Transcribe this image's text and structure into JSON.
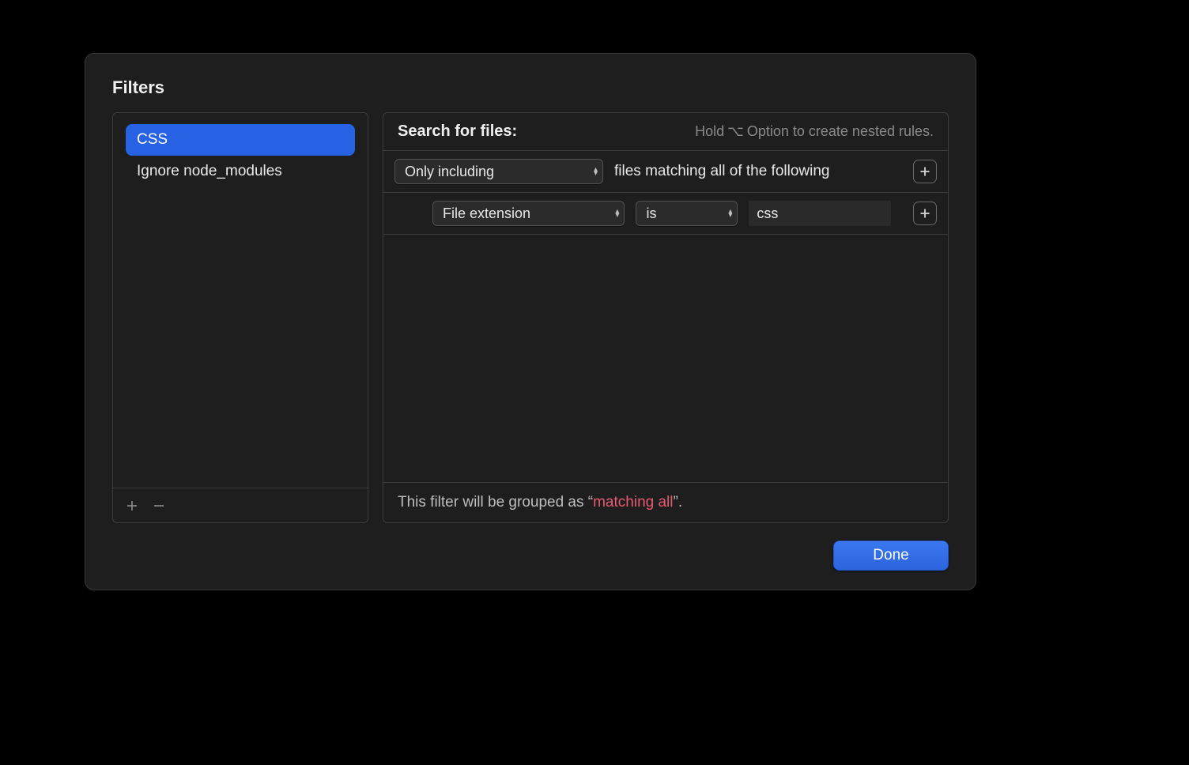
{
  "title": "Filters",
  "sidebar": {
    "items": [
      {
        "label": "CSS",
        "selected": true
      },
      {
        "label": "Ignore node_modules",
        "selected": false
      }
    ]
  },
  "editor": {
    "header_label": "Search for files:",
    "hint_prefix": "Hold ",
    "hint_symbol": "⌥",
    "hint_suffix": " Option to create nested rules.",
    "scope_select": "Only including",
    "scope_suffix": "files matching all of the following",
    "criteria": [
      {
        "attribute": "File extension",
        "operator": "is",
        "value": "css"
      }
    ],
    "footer_prefix": "This filter will be grouped as “",
    "footer_hl": "matching all",
    "footer_suffix": "”."
  },
  "buttons": {
    "done": "Done"
  }
}
